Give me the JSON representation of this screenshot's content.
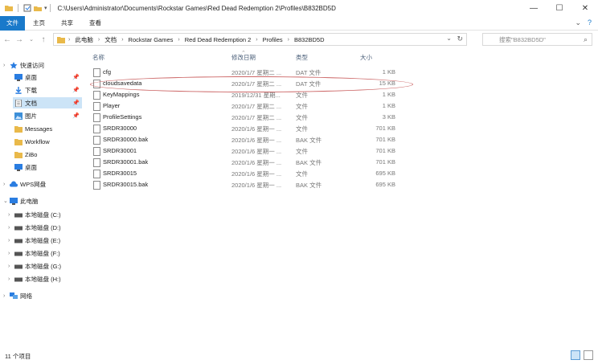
{
  "window": {
    "path": "C:\\Users\\Administrator\\Documents\\Rockstar Games\\Red Dead Redemption 2\\Profiles\\B832BD5D",
    "minimize": "—",
    "maximize": "☐",
    "close": "✕"
  },
  "ribbon": {
    "tabs": [
      "文件",
      "主页",
      "共享",
      "查看"
    ],
    "collapse_icon": "chevron-down-icon",
    "help_icon": "help-icon"
  },
  "address": {
    "crumbs": [
      "此电脑",
      "文档",
      "Rockstar Games",
      "Red Dead Redemption 2",
      "Profiles",
      "B832BD5D"
    ],
    "search_placeholder": "搜索\"B832BD5D\""
  },
  "nav": {
    "quick_access": "快速访问",
    "pinned": [
      {
        "label": "桌面",
        "icon": "desktop-icon"
      },
      {
        "label": "下载",
        "icon": "download-icon"
      },
      {
        "label": "文档",
        "icon": "documents-icon"
      },
      {
        "label": "图片",
        "icon": "pictures-icon"
      }
    ],
    "folders": [
      "Messages",
      "Workflow",
      "ZiBo",
      "桌面"
    ],
    "wps": "WPS网盘",
    "this_pc": "此电脑",
    "drives": [
      "本地磁盘 (C:)",
      "本地磁盘 (D:)",
      "本地磁盘 (E:)",
      "本地磁盘 (F:)",
      "本地磁盘 (G:)",
      "本地磁盘 (H:)"
    ],
    "network": "网络"
  },
  "columns": {
    "name": "名称",
    "date": "修改日期",
    "type": "类型",
    "size": "大小"
  },
  "files": [
    {
      "name": "cfg",
      "date": "2020/1/7 星期二 ...",
      "type": "DAT 文件",
      "size": "1 KB"
    },
    {
      "name": "cloudsavedata",
      "date": "2020/1/7 星期二 ...",
      "type": "DAT 文件",
      "size": "15 KB"
    },
    {
      "name": "KeyMappings",
      "date": "2019/12/31 星期...",
      "type": "文件",
      "size": "1 KB"
    },
    {
      "name": "Player",
      "date": "2020/1/7 星期二 ...",
      "type": "文件",
      "size": "1 KB"
    },
    {
      "name": "ProfileSettings",
      "date": "2020/1/7 星期二 ...",
      "type": "文件",
      "size": "3 KB"
    },
    {
      "name": "SRDR30000",
      "date": "2020/1/6 星期一 ...",
      "type": "文件",
      "size": "701 KB"
    },
    {
      "name": "SRDR30000.bak",
      "date": "2020/1/6 星期一 ...",
      "type": "BAK 文件",
      "size": "701 KB"
    },
    {
      "name": "SRDR30001",
      "date": "2020/1/6 星期一 ...",
      "type": "文件",
      "size": "701 KB"
    },
    {
      "name": "SRDR30001.bak",
      "date": "2020/1/6 星期一 ...",
      "type": "BAK 文件",
      "size": "701 KB"
    },
    {
      "name": "SRDR30015",
      "date": "2020/1/6 星期一 ...",
      "type": "文件",
      "size": "695 KB"
    },
    {
      "name": "SRDR30015.bak",
      "date": "2020/1/6 星期一 ...",
      "type": "BAK 文件",
      "size": "695 KB"
    }
  ],
  "status": {
    "count": "11 个项目"
  },
  "colors": {
    "accent": "#1979ca",
    "selection": "#cce4f7",
    "annotation": "#cc6666"
  }
}
